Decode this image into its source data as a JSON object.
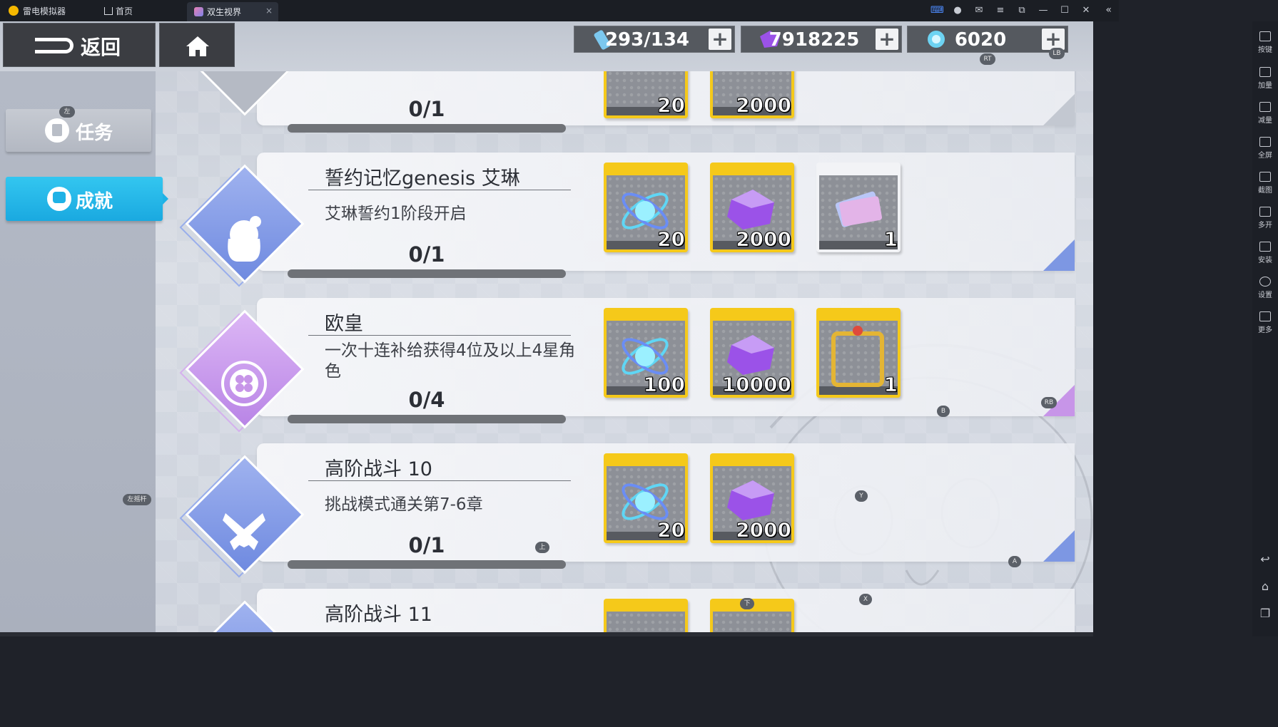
{
  "titlebar": {
    "app_name": "雷电模拟器",
    "home_tab": "首页",
    "game_tab": "双生视界",
    "close": "×"
  },
  "sidebar": {
    "items": [
      {
        "label": "按键",
        "icon": "keyboard-icon"
      },
      {
        "label": "加量",
        "icon": "volume-up-icon"
      },
      {
        "label": "减量",
        "icon": "volume-down-icon"
      },
      {
        "label": "全屏",
        "icon": "fullscreen-icon"
      },
      {
        "label": "截图",
        "icon": "scissors-icon"
      },
      {
        "label": "多开",
        "icon": "multi-instance-icon"
      },
      {
        "label": "安装",
        "icon": "apk-icon"
      },
      {
        "label": "设置",
        "icon": "gear-icon"
      },
      {
        "label": "更多",
        "icon": "more-icon"
      }
    ]
  },
  "topbar": {
    "back_label": "返回",
    "resources": [
      {
        "name": "stamina",
        "value": "293/134",
        "icon": "stamina-vial-icon"
      },
      {
        "name": "crystal",
        "value": "7918225",
        "icon": "crystal-icon"
      },
      {
        "name": "gem",
        "value": "6020",
        "icon": "blue-gem-icon"
      }
    ],
    "plus": "+"
  },
  "nav": {
    "task_label": "任务",
    "achievement_label": "成就"
  },
  "hints": {
    "left": "左",
    "rt": "RT",
    "lb": "LB",
    "rb": "RB",
    "b": "B",
    "y": "Y",
    "a": "A",
    "x": "X",
    "up": "上",
    "down": "下",
    "stick": "左摇杆"
  },
  "achievements": [
    {
      "title": "",
      "desc": "",
      "progress": "0/1",
      "rewards": [
        {
          "type": "gem",
          "amount": "20"
        },
        {
          "type": "crystal",
          "amount": "2000"
        }
      ]
    },
    {
      "title": "誓约记忆genesis 艾琳",
      "desc": "艾琳誓约1阶段开启",
      "progress": "0/1",
      "icon": "girl-portrait-icon",
      "rewards": [
        {
          "type": "gem",
          "amount": "20"
        },
        {
          "type": "crystal",
          "amount": "2000"
        },
        {
          "type": "ticket",
          "amount": "1"
        }
      ]
    },
    {
      "title": "欧皇",
      "desc": "一次十连补给获得4位及以上4星角色",
      "progress": "0/4",
      "icon": "clover-badge-icon",
      "rewards": [
        {
          "type": "gem",
          "amount": "100"
        },
        {
          "type": "crystal",
          "amount": "10000"
        },
        {
          "type": "frame",
          "amount": "1"
        }
      ]
    },
    {
      "title": "高阶战斗 10",
      "desc": "挑战模式通关第7-6章",
      "progress": "0/1",
      "icon": "crossed-pistols-icon",
      "rewards": [
        {
          "type": "gem",
          "amount": "20"
        },
        {
          "type": "crystal",
          "amount": "2000"
        }
      ]
    },
    {
      "title": "高阶战斗 11",
      "desc": "",
      "progress": "",
      "rewards": []
    }
  ],
  "partial_amounts": {
    "gem": "20",
    "crystal": "2000"
  },
  "colors": {
    "accent_blue": "#1fb2e6",
    "reward_gold": "#f5c91a",
    "diamond_blue": "#7b96e6",
    "diamond_purple": "#c795e8"
  }
}
